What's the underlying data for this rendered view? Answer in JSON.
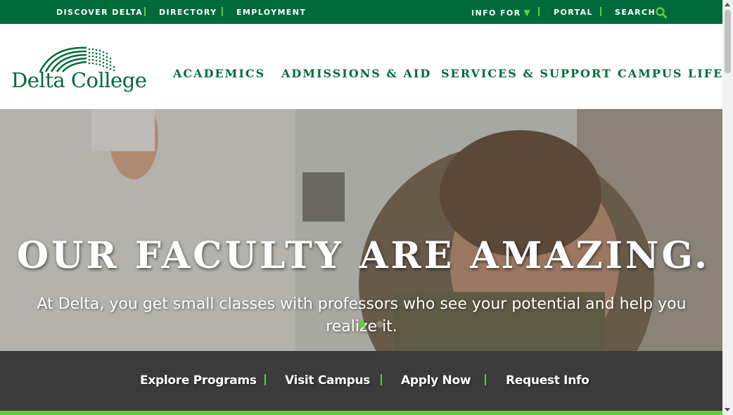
{
  "topbar": {
    "links": [
      "DISCOVER DELTA",
      "DIRECTORY",
      "EMPLOYMENT"
    ],
    "info_for": "INFO FOR",
    "portal": "PORTAL",
    "search": "SEARCH"
  },
  "logo": {
    "text": "Delta College"
  },
  "nav": [
    "ACADEMICS",
    "ADMISSIONS & AID",
    "SERVICES & SUPPORT",
    "CAMPUS LIFE"
  ],
  "hero": {
    "title": "OUR FACULTY ARE AMAZING.",
    "subtitle": "At Delta, you get small classes with professors who see your potential and help you realize it."
  },
  "cta": [
    "Explore Programs",
    "Visit Campus",
    "Apply Now",
    "Request Info"
  ],
  "colors": {
    "brand_green": "#006a3b",
    "accent_green": "#5fcf3e",
    "cta_bg": "#3b3b3b"
  }
}
